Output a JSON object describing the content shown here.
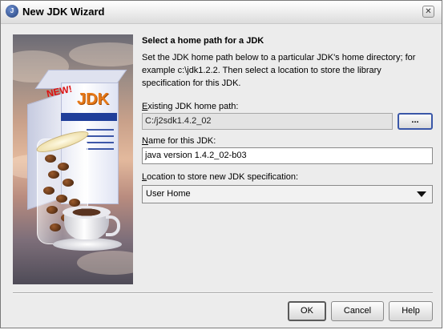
{
  "window": {
    "title": "New JDK Wizard",
    "app_icon": "java-icon",
    "close_icon": "close-icon"
  },
  "content": {
    "heading": "Select a home path for a JDK",
    "description": "Set the JDK home path below to a particular JDK's home directory; for example c:\\jdk1.2.2. Then select a location to store the library specification for this JDK."
  },
  "form": {
    "home_path_label_mnemonic": "E",
    "home_path_label_rest": "xisting JDK home path:",
    "home_path_value": "C:/j2sdk1.4.2_02",
    "browse_label": "...",
    "name_label_mnemonic": "N",
    "name_label_rest": "ame for this JDK:",
    "name_value": "java version 1.4.2_02-b03",
    "location_label_mnemonic": "L",
    "location_label_rest": "ocation to store new JDK specification:",
    "location_selected": "User Home"
  },
  "image": {
    "logo_text": "JDK",
    "badge_text": "NEW!"
  },
  "buttons": {
    "ok": "OK",
    "cancel": "Cancel",
    "help": "Help"
  }
}
